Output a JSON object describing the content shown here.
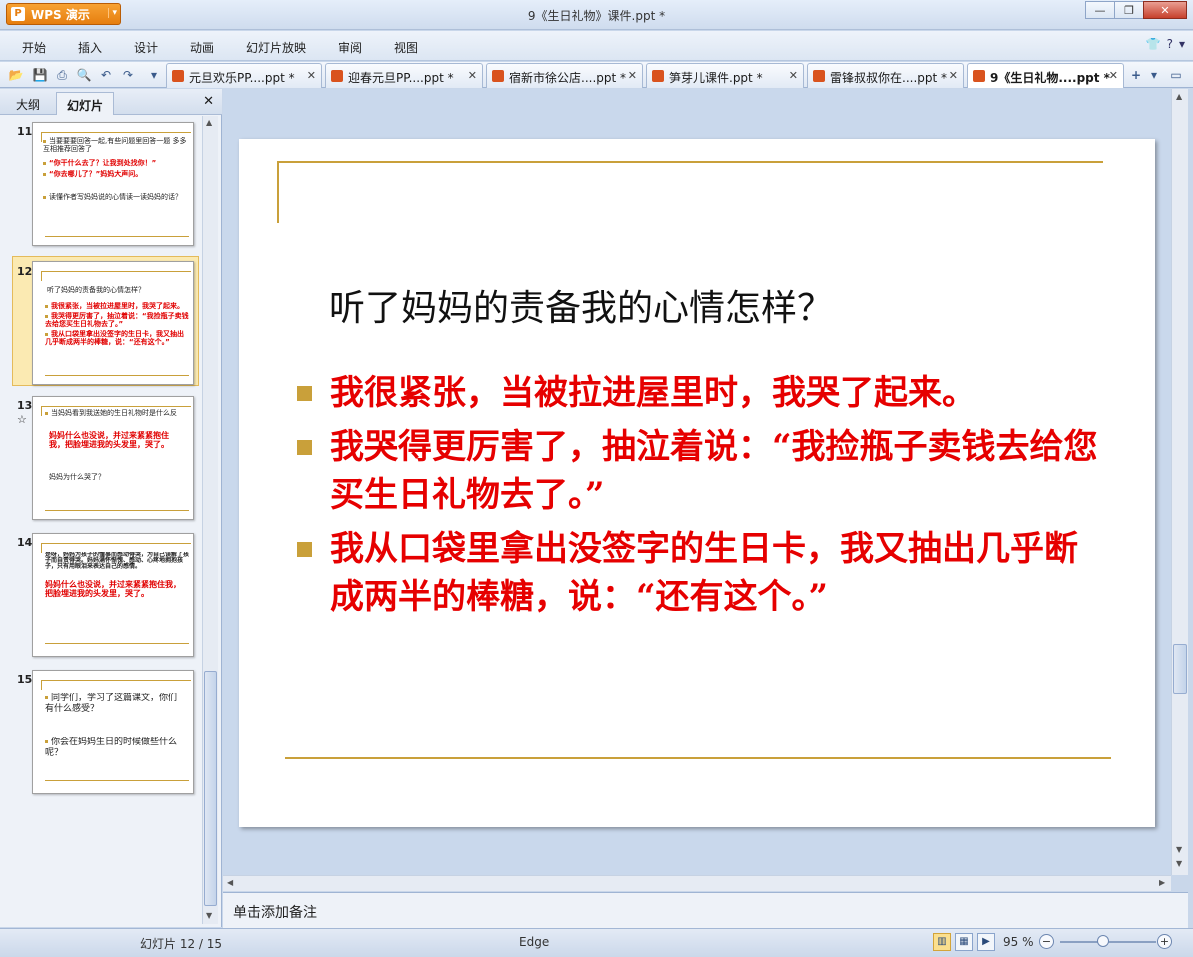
{
  "app": {
    "name": "WPS 演示",
    "window_title": "9《生日礼物》课件.ppt *"
  },
  "menu": [
    "开始",
    "插入",
    "设计",
    "动画",
    "幻灯片放映",
    "审阅",
    "视图"
  ],
  "tabs": [
    {
      "label": "元旦欢乐PP....ppt *"
    },
    {
      "label": "迎春元旦PP....ppt *"
    },
    {
      "label": "宿新市徐公店....ppt *"
    },
    {
      "label": "笋芽儿课件.ppt *"
    },
    {
      "label": "雷锋叔叔你在....ppt *"
    },
    {
      "label": "9《生日礼物....ppt *"
    }
  ],
  "panel": {
    "tab_outline": "大纲",
    "tab_slides": "幻灯片"
  },
  "thumbnails": [
    {
      "num": "11",
      "lines": [
        "当要要要回答一起,有些问题里回答一题 多多互相推荐回答了",
        "“你干什么去了？让我到处找你！”",
        "“你去哪儿了？”妈妈大声问。",
        "读懂作者写妈妈说的心情读一读妈妈的话？"
      ]
    },
    {
      "num": "12",
      "lines": [
        "听了妈妈的责备我的心情怎样？",
        "我很紧张，当被拉进屋里时，我哭了起来。",
        "我哭得更厉害了，抽泣着说：“我捡瓶子卖钱去给您买生日礼物去了。”",
        "我从口袋里拿出没签字的生日卡，我又抽出几乎断成两半的棒糖，说：“还有这个。”"
      ]
    },
    {
      "num": "13",
      "extra": "☆",
      "lines": [
        "当妈妈看到我送她的生日礼物时是什么反映？",
        "妈妈什么也没说，并过来紧紧抱住我，把脸埋进我的头发里，哭了。",
        "妈妈为什么哭了？"
      ]
    },
    {
      "num": "14",
      "lines": [
        "是呀，妈妈为孩子的懂事而感动得哭，为自己误解了孩子而自责得哭。妈妈满怀惭愧、感动、心疼地拥抱孩子，只有用眼泪来表达自己的感情。",
        "妈妈什么也没说，并过来紧紧抱住我，把脸埋进我的头发里，哭了。"
      ]
    },
    {
      "num": "15",
      "lines": [
        "同学们，学习了这篇课文，你们有什么感受？",
        "你会在妈妈生日的时候做些什么呢？"
      ]
    }
  ],
  "slide": {
    "title": "听了妈妈的责备我的心情怎样？",
    "bullets": [
      "我很紧张，当被拉进屋里时，我哭了起来。",
      "我哭得更厉害了，抽泣着说：“我捡瓶子卖钱去给您买生日礼物去了。”",
      "我从口袋里拿出没签字的生日卡，我又抽出几乎断成两半的棒糖，说：“还有这个。”"
    ]
  },
  "notes_placeholder": "单击添加备注",
  "status": {
    "slide_info": "幻灯片 12 / 15",
    "theme": "Edge",
    "zoom": "95 %"
  },
  "colors": {
    "accent_gold": "#c9a03a",
    "body_red": "#e60000",
    "app_orange": "#f7a233"
  }
}
